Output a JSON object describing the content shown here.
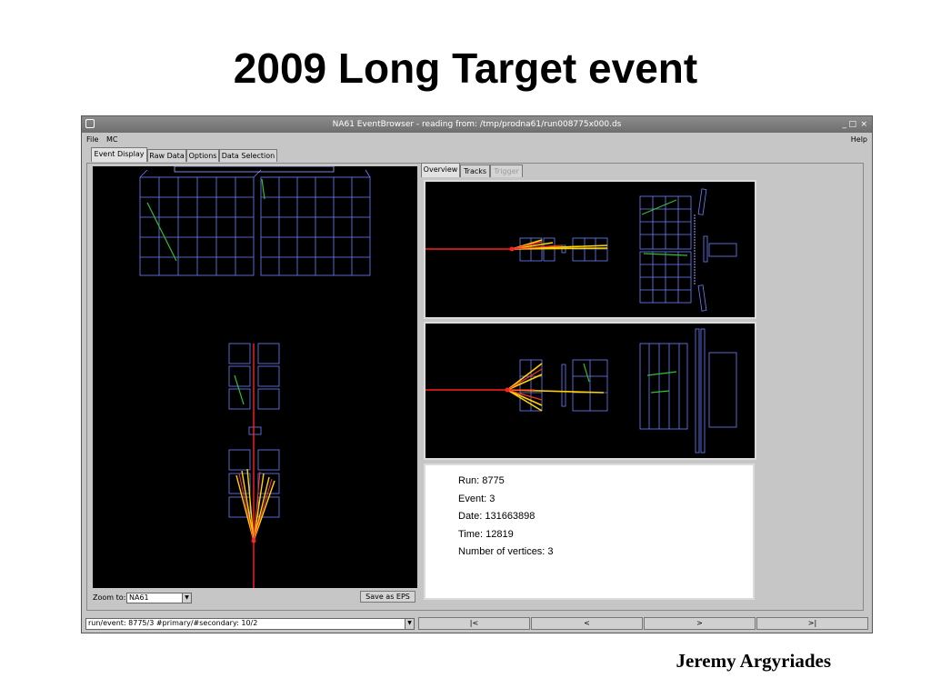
{
  "slide": {
    "title": "2009 Long Target event",
    "author": "Jeremy Argyriades"
  },
  "window": {
    "title": "NA61 EventBrowser - reading from: /tmp/prodna61/run008775x000.ds",
    "controls": [
      "_",
      "□",
      "×"
    ]
  },
  "menu": {
    "file": "File",
    "mc": "MC",
    "help": "Help"
  },
  "main_tabs": [
    "Event Display",
    "Raw Data",
    "Options",
    "Data Selection"
  ],
  "side_tabs": [
    "Overview",
    "Tracks",
    "Trigger"
  ],
  "info": {
    "run": "Run: 8775",
    "event": "Event: 3",
    "date": "Date: 131663898",
    "time": "Time: 12819",
    "vertices": "Number of vertices: 3"
  },
  "zoom": {
    "label": "Zoom to:",
    "value": "NA61"
  },
  "save_eps": "Save as EPS",
  "event_select": {
    "value": "run/event: 8775/3 #primary/#secondary: 10/2"
  },
  "nav": {
    "first": "|<",
    "prev": "<",
    "next": ">",
    "last": ">|"
  },
  "colors": {
    "beam": "#ff2020",
    "tracks": "#ffd400",
    "detector": "#7080ff",
    "hits": "#30c030"
  }
}
